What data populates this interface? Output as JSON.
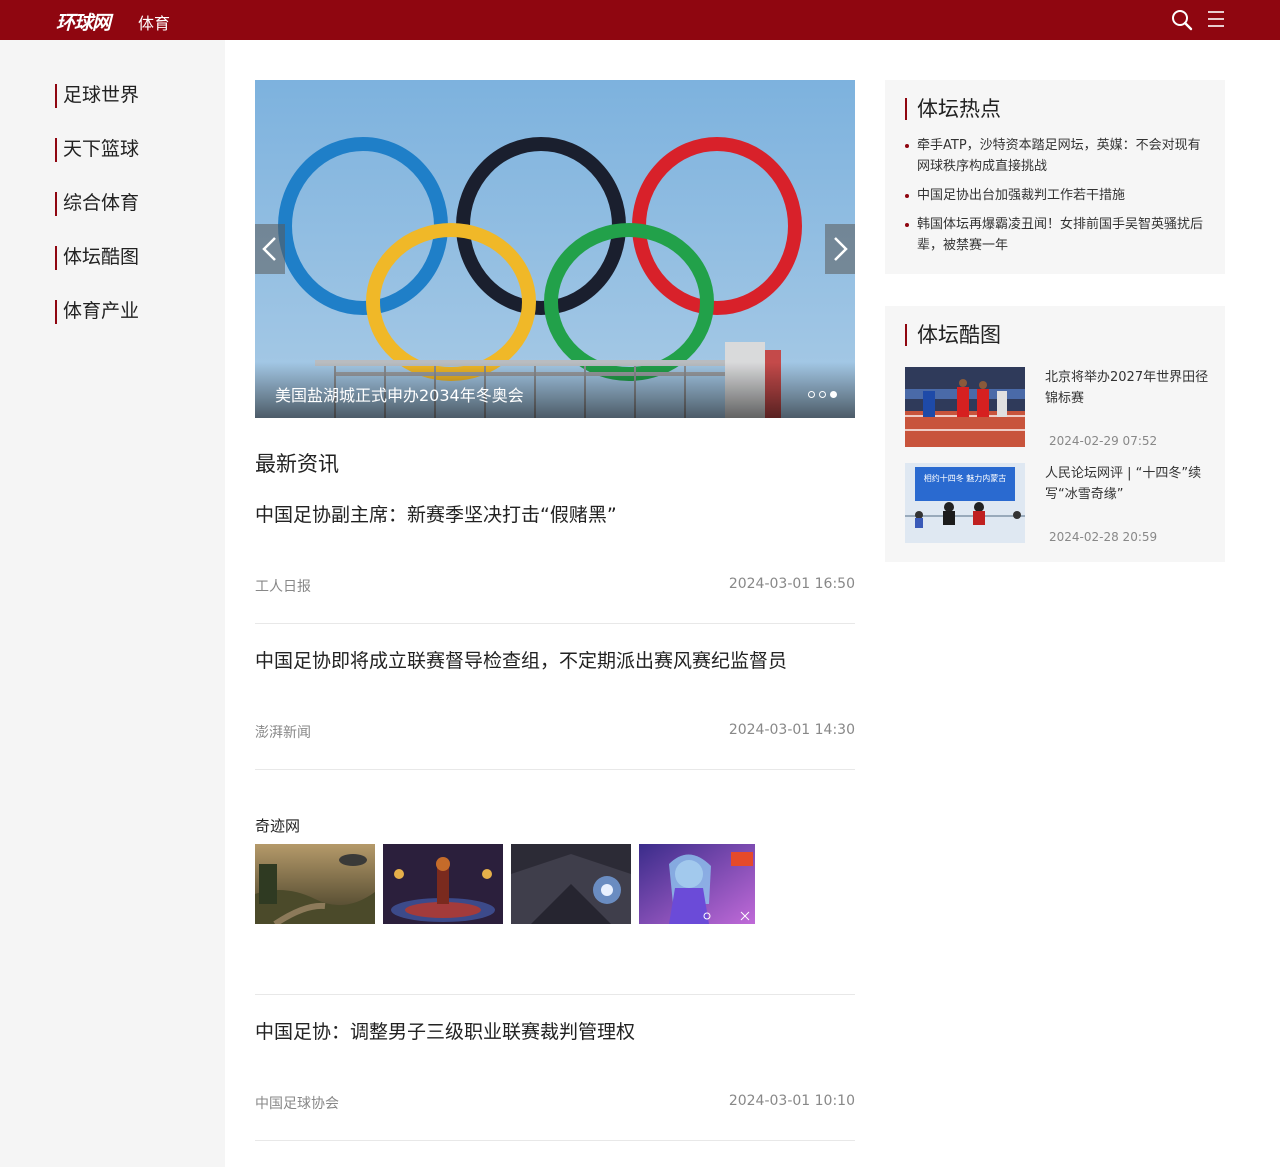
{
  "header": {
    "logo": "环球网",
    "channel": "体育"
  },
  "sidebar": {
    "items": [
      {
        "label": "足球世界"
      },
      {
        "label": "天下篮球"
      },
      {
        "label": "综合体育"
      },
      {
        "label": "体坛酷图"
      },
      {
        "label": "体育产业"
      }
    ]
  },
  "carousel": {
    "caption": "美国盐湖城正式申办2034年冬奥会",
    "slide_count": 3,
    "active_slide": 3
  },
  "latest": {
    "title": "最新资讯",
    "items": [
      {
        "title": "中国足协副主席：新赛季坚决打击“假赌黑”",
        "source": "工人日报",
        "time": "2024-03-01 16:50"
      },
      {
        "title": "中国足协即将成立联赛督导检查组，不定期派出赛风赛纪监督员",
        "source": "澎湃新闻",
        "time": "2024-03-01 14:30"
      },
      {
        "title": "中国足协：调整男子三级职业联赛裁判管理权",
        "source": "中国足球协会",
        "time": "2024-03-01 10:10"
      }
    ]
  },
  "ad": {
    "brand": "奇迹网"
  },
  "hot": {
    "title": "体坛热点",
    "items": [
      {
        "text": "牵手ATP，沙特资本踏足网坛，英媒：不会对现有网球秩序构成直接挑战"
      },
      {
        "text": "中国足协出台加强裁判工作若干措施"
      },
      {
        "text": "韩国体坛再爆霸凌丑闻！女排前国手吴智英骚扰后辈，被禁赛一年"
      }
    ]
  },
  "gallery": {
    "title": "体坛酷图",
    "items": [
      {
        "title": "北京将举办2027年世界田径锦标赛",
        "date": "2024-02-29 07:52"
      },
      {
        "title": "人民论坛网评 | “十四冬”续写“冰雪奇缘”",
        "date": "2024-02-28 20:59",
        "banner": "相约十四冬 魅力内蒙古"
      }
    ]
  },
  "colors": {
    "brand": "#8f0610"
  }
}
